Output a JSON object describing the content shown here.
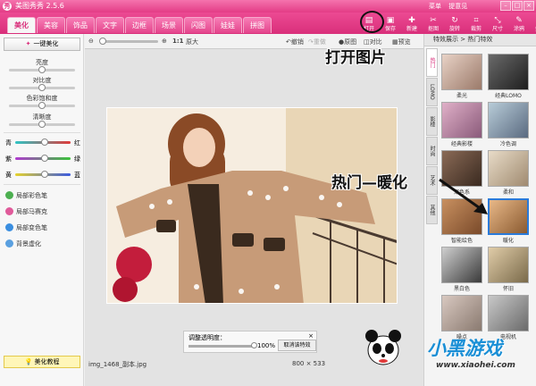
{
  "app": {
    "title": "美图秀秀 2.5.6",
    "logo": "秀",
    "menu_links": [
      "菜单",
      "提意见"
    ],
    "window_buttons": [
      "–",
      "□",
      "×"
    ]
  },
  "tabs": [
    "美化",
    "美容",
    "饰品",
    "文字",
    "边框",
    "场景",
    "闪图",
    "娃娃",
    "拼图"
  ],
  "active_tab": "美化",
  "toolbar": [
    {
      "label": "打开",
      "icon": "open-folder-icon",
      "glyph": "▤"
    },
    {
      "label": "保存",
      "icon": "save-icon",
      "glyph": "▣"
    },
    {
      "label": "新建",
      "icon": "new-icon",
      "glyph": "✚"
    },
    {
      "label": "抠图",
      "icon": "cutout-icon",
      "glyph": "✂"
    },
    {
      "label": "旋转",
      "icon": "rotate-icon",
      "glyph": "↻"
    },
    {
      "label": "裁剪",
      "icon": "crop-icon",
      "glyph": "⌗"
    },
    {
      "label": "尺寸",
      "icon": "resize-icon",
      "glyph": "⤡"
    },
    {
      "label": "涂鸦",
      "icon": "brush-icon",
      "glyph": "✎"
    },
    {
      "label": "拍照",
      "icon": "camera-icon",
      "glyph": "◙"
    }
  ],
  "left_panel": {
    "one_click": "一键美化",
    "sliders": [
      {
        "label": "亮度",
        "value": 0.5
      },
      {
        "label": "对比度",
        "value": 0.5
      },
      {
        "label": "色彩饱和度",
        "value": 0.5
      },
      {
        "label": "清晰度",
        "value": 0.5
      }
    ],
    "color_balance": [
      {
        "left": "青",
        "right": "红",
        "colors": [
          "#2ec4c4",
          "#e03a3a"
        ]
      },
      {
        "left": "紫",
        "right": "绿",
        "colors": [
          "#b03ad0",
          "#3ac43a"
        ]
      },
      {
        "left": "黄",
        "right": "蓝",
        "colors": [
          "#e6d22c",
          "#3a5ae0"
        ]
      }
    ],
    "brushes": [
      {
        "label": "局部彩色笔",
        "color": "#4caf50"
      },
      {
        "label": "局部马赛克",
        "color": "#e05a9a"
      },
      {
        "label": "局部变色笔",
        "color": "#3a8ee0"
      },
      {
        "label": "背景虚化",
        "color": "#5aa0e0"
      }
    ],
    "tutorial": "美化教程"
  },
  "center": {
    "zoom_label": "1:1",
    "original_size": "原大",
    "actions": [
      "撤销",
      "重做",
      "原图",
      "对比",
      "预览"
    ],
    "filename": "img_1468_副本.jpg",
    "dimensions": "800 × 533",
    "opacity_panel": {
      "title": "调整透明度：",
      "percent": "100%",
      "value": 1.0,
      "cancel": "取消该特效",
      "close": "×"
    }
  },
  "right_panel": {
    "header": "特效展示 > 热门特效",
    "categories": [
      "热门",
      "LOMO",
      "影楼",
      "时尚",
      "艺术",
      "其他"
    ],
    "active_category": "热门",
    "effects": [
      {
        "label": "柔光",
        "colors": [
          "#e8d2c6",
          "#9b7a6a"
        ]
      },
      {
        "label": "经典LOMO",
        "colors": [
          "#6a6a6a",
          "#1e1e1e"
        ]
      },
      {
        "label": "经典影楼",
        "colors": [
          "#e0b0c8",
          "#8a5a7a"
        ]
      },
      {
        "label": "冷色调",
        "colors": [
          "#b8ccd8",
          "#5a6a80"
        ]
      },
      {
        "label": "深色系",
        "colors": [
          "#8a6a56",
          "#3a2a20"
        ]
      },
      {
        "label": "柔和",
        "colors": [
          "#e8dcc8",
          "#a08a70"
        ]
      },
      {
        "label": "智能绘色",
        "colors": [
          "#c89060",
          "#7a4a2a"
        ]
      },
      {
        "label": "暖化",
        "colors": [
          "#e8b888",
          "#8a5a30"
        ]
      },
      {
        "label": "黑白色",
        "colors": [
          "#cfcfcf",
          "#3a3a3a"
        ]
      },
      {
        "label": "怀旧",
        "colors": [
          "#e0cca8",
          "#7a6a4a"
        ]
      },
      {
        "label": "噪点",
        "colors": [
          "#d8c8c0",
          "#8a7a70"
        ]
      },
      {
        "label": "电视机",
        "colors": [
          "#c8c8c8",
          "#6a6a6a"
        ]
      }
    ],
    "selected_effect": "暖化"
  },
  "annotations": {
    "open_picture": "打开图片",
    "hot_warm": "热门—暖化"
  },
  "watermark": {
    "title": "小黑游戏",
    "url": "www.xiaohei.com"
  }
}
